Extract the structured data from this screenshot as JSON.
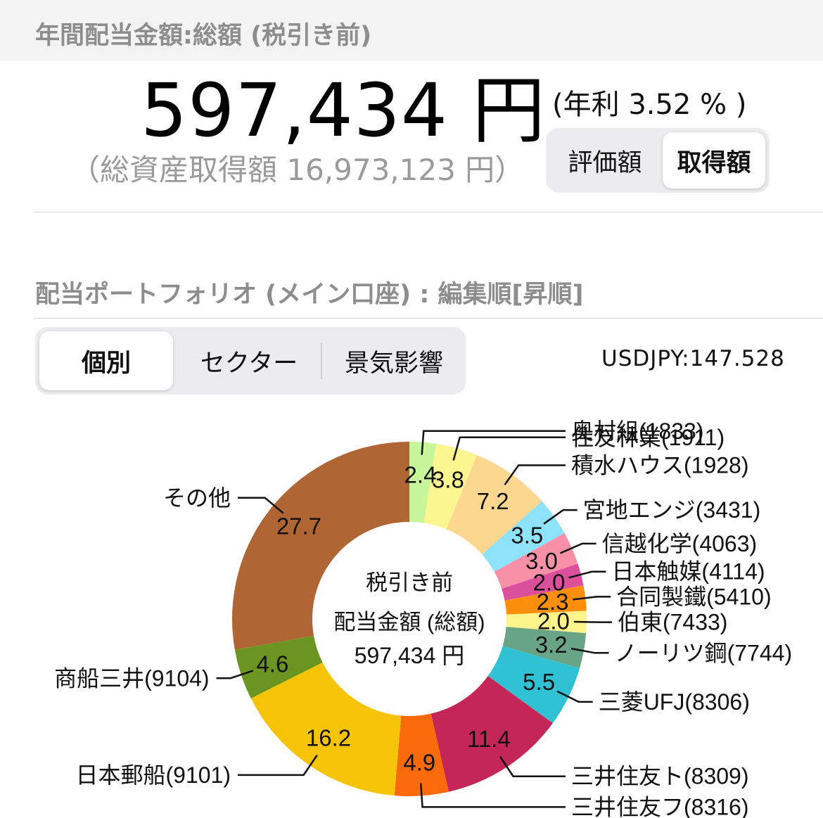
{
  "header": {
    "title": "年間配当金額:総額 (税引き前)",
    "amount": "597,434 円",
    "yield": "(年利 3.52 % )",
    "total_assets": "（総資産取得額 16,973,123 円）"
  },
  "basis_toggle": {
    "options": [
      "評価額",
      "取得額"
    ],
    "selected": "取得額"
  },
  "portfolio": {
    "title": "配当ポートフォリオ (メイン口座) : 編集順[昇順]",
    "tabs": [
      "個別",
      "セクター",
      "景気影響"
    ],
    "selected_tab": "個別",
    "rate": "USDJPY:147.528"
  },
  "chart_data": {
    "type": "pie",
    "variant": "donut",
    "unit": "%",
    "center_text": [
      "税引き前",
      "配当金額 (総額)",
      "597,434 円"
    ],
    "slices": [
      {
        "label": "奥村組(1833)",
        "value": 2.4,
        "color": "#c6f59a"
      },
      {
        "label": "住友林業(1911)",
        "value": 3.8,
        "color": "#fbf68f"
      },
      {
        "label": "積水ハウス(1928)",
        "value": 7.2,
        "color": "#fdd68f"
      },
      {
        "label": "宮地エンジ(3431)",
        "value": 3.5,
        "color": "#8ee3fa"
      },
      {
        "label": "信越化学(4063)",
        "value": 3.0,
        "color": "#f891a8"
      },
      {
        "label": "日本触媒(4114)",
        "value": 2.0,
        "color": "#dc4f9a"
      },
      {
        "label": "合同製鐵(5410)",
        "value": 2.3,
        "color": "#fb8f0c"
      },
      {
        "label": "伯東(7433)",
        "value": 2.0,
        "color": "#fdf58c"
      },
      {
        "label": "ノーリツ鋼(7744)",
        "value": 3.2,
        "color": "#6aa487"
      },
      {
        "label": "三菱UFJ(8306)",
        "value": 5.5,
        "color": "#31c1d4"
      },
      {
        "label": "三井住友ト(8309)",
        "value": 11.4,
        "color": "#c42657"
      },
      {
        "label": "三井住友フ(8316)",
        "value": 4.9,
        "color": "#fb6a0a"
      },
      {
        "label": "日本郵船(9101)",
        "value": 16.2,
        "color": "#f5c407"
      },
      {
        "label": "商船三井(9104)",
        "value": 4.6,
        "color": "#6a9521"
      },
      {
        "label": "その他",
        "value": 27.7,
        "color": "#b06534"
      }
    ]
  }
}
